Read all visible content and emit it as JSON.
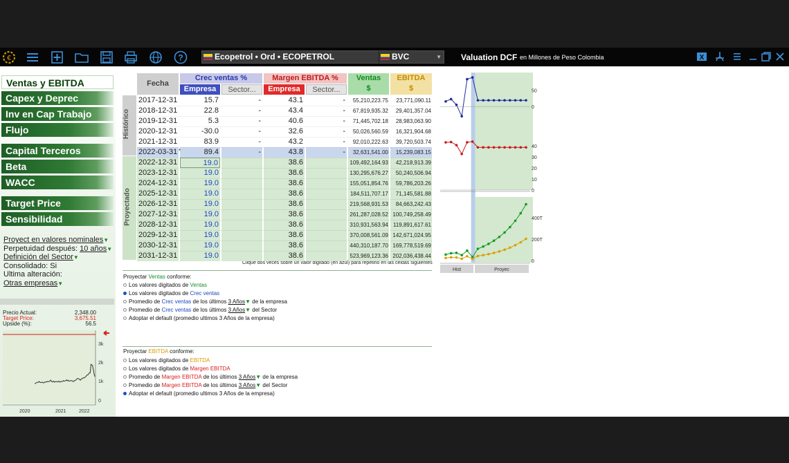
{
  "toolbar": {
    "company_combo": "Ecopetrol • Ord • ECOPETROL",
    "exchange_combo": "BVC",
    "title": "Valuation DCF",
    "subtitle": "en Millones de Peso Colombia",
    "icons": [
      "logo-icon",
      "menu-icon",
      "add-icon",
      "folder-icon",
      "save-icon",
      "print-icon",
      "globe-icon",
      "help-icon"
    ],
    "right_icons": [
      "excel-icon",
      "pdf-icon",
      "list-icon",
      "minimize-icon",
      "restore-icon",
      "close-icon"
    ]
  },
  "sidebar": {
    "nav": [
      "Ventas y EBITDA",
      "Capex y Deprec",
      "Inv en Cap Trabajo",
      "Flujo",
      "Capital Terceros",
      "Beta",
      "WACC",
      "Target Price",
      "Sensibilidad"
    ],
    "settings": {
      "proyect": "Proyect en valores nominales",
      "perpetuidad_label": "Perpetuidad después:",
      "perpetuidad_value": "10 años",
      "definicion": "Definición del Sector",
      "consolidado": "Consolidado: Si",
      "ultima": "Ultima alteración:",
      "otras": "Otras empresas"
    },
    "price": {
      "actual_label": "Precio Actual:",
      "actual_value": "2,348.00",
      "target_label": "Target Price:",
      "target_value": "3,675.51",
      "upside_label": "Upside (%):",
      "upside_value": "56.5"
    },
    "mini_chart": {
      "yticks": [
        "3k",
        "2k",
        "1k",
        "0"
      ],
      "xticks": [
        "2020",
        "2021",
        "2022"
      ]
    }
  },
  "table": {
    "headers": {
      "fecha": "Fecha",
      "crec": "Crec ventas %",
      "margen": "Margen EBITDA %",
      "ventas": "Ventas",
      "ventas_unit": "$",
      "ebitda": "EBITDA",
      "ebitda_unit": "$",
      "empresa": "Empresa",
      "sector": "Sector..."
    },
    "sections": {
      "historico": "Histórico",
      "proyectado": "Proyectado"
    },
    "rows": [
      {
        "fecha": "2017-12-31",
        "crec": "15.7",
        "crec_s": "-",
        "margen": "43.1",
        "margen_s": "-",
        "ventas": "55,210,223.75",
        "ebitda": "23,771,090.11",
        "type": "hist"
      },
      {
        "fecha": "2018-12-31",
        "crec": "22.8",
        "crec_s": "-",
        "margen": "43.4",
        "margen_s": "-",
        "ventas": "67,819,935.32",
        "ebitda": "29,401,357.04",
        "type": "hist"
      },
      {
        "fecha": "2019-12-31",
        "crec": "5.3",
        "crec_s": "-",
        "margen": "40.6",
        "margen_s": "-",
        "ventas": "71,445,702.18",
        "ebitda": "28,983,063.90",
        "type": "hist"
      },
      {
        "fecha": "2020-12-31",
        "crec": "-30.0",
        "crec_s": "-",
        "margen": "32.6",
        "margen_s": "-",
        "ventas": "50,026,560.59",
        "ebitda": "16,321,904.68",
        "type": "hist"
      },
      {
        "fecha": "2021-12-31",
        "crec": "83.9",
        "crec_s": "-",
        "margen": "43.2",
        "margen_s": "-",
        "ventas": "92,010,222.63",
        "ebitda": "39,720,503.74",
        "type": "hist"
      },
      {
        "fecha": "2022-03-31",
        "crec": "89.4",
        "crec_s": "-",
        "margen": "43.8",
        "margen_s": "-",
        "ventas": "32,631,541.00",
        "ebitda": "15,239,083.15",
        "type": "sel"
      },
      {
        "fecha": "2022-12-31",
        "crec": "19.0",
        "crec_s": "",
        "margen": "38.6",
        "margen_s": "",
        "ventas": "109,492,164.93",
        "ebitda": "42,218,913.39",
        "type": "proj"
      },
      {
        "fecha": "2023-12-31",
        "crec": "19.0",
        "crec_s": "",
        "margen": "38.6",
        "margen_s": "",
        "ventas": "130,295,676.27",
        "ebitda": "50,240,506.94",
        "type": "proj"
      },
      {
        "fecha": "2024-12-31",
        "crec": "19.0",
        "crec_s": "",
        "margen": "38.6",
        "margen_s": "",
        "ventas": "155,051,854.76",
        "ebitda": "59,786,203.26",
        "type": "proj"
      },
      {
        "fecha": "2025-12-31",
        "crec": "19.0",
        "crec_s": "",
        "margen": "38.6",
        "margen_s": "",
        "ventas": "184,511,707.17",
        "ebitda": "71,145,581.88",
        "type": "proj"
      },
      {
        "fecha": "2026-12-31",
        "crec": "19.0",
        "crec_s": "",
        "margen": "38.6",
        "margen_s": "",
        "ventas": "219,568,931.53",
        "ebitda": "84,663,242.43",
        "type": "proj"
      },
      {
        "fecha": "2027-12-31",
        "crec": "19.0",
        "crec_s": "",
        "margen": "38.6",
        "margen_s": "",
        "ventas": "261,287,028.52",
        "ebitda": "100,749,258.49",
        "type": "proj"
      },
      {
        "fecha": "2028-12-31",
        "crec": "19.0",
        "crec_s": "",
        "margen": "38.6",
        "margen_s": "",
        "ventas": "310,931,563.94",
        "ebitda": "119,891,617.61",
        "type": "proj"
      },
      {
        "fecha": "2029-12-31",
        "crec": "19.0",
        "crec_s": "",
        "margen": "38.6",
        "margen_s": "",
        "ventas": "370,008,561.09",
        "ebitda": "142,671,024.95",
        "type": "proj"
      },
      {
        "fecha": "2030-12-31",
        "crec": "19.0",
        "crec_s": "",
        "margen": "38.6",
        "margen_s": "",
        "ventas": "440,310,187.70",
        "ebitda": "169,778,519.69",
        "type": "proj"
      },
      {
        "fecha": "2031-12-31",
        "crec": "19.0",
        "crec_s": "",
        "margen": "38.6",
        "margen_s": "",
        "ventas": "523,969,123.36",
        "ebitda": "202,036,438.44",
        "type": "proj"
      }
    ],
    "note": "Clique dos veces sobre un valor digitado (en azul) para repetirlo en las celdas siguientes"
  },
  "charts": {
    "crec_ticks": [
      "50",
      "0"
    ],
    "margen_ticks": [
      "40",
      "30",
      "20",
      "10",
      "0"
    ],
    "ventas_ticks": [
      "400T",
      "200T",
      "0"
    ],
    "footer_hist": "Hist",
    "footer_proyec": "Proyec",
    "series_crec": [
      15.7,
      22.8,
      5.3,
      -30.0,
      83.9,
      89.4,
      19,
      19,
      19,
      19,
      19,
      19,
      19,
      19,
      19,
      19
    ],
    "series_margen": [
      43.1,
      43.4,
      40.6,
      32.6,
      43.2,
      43.8,
      38.6,
      38.6,
      38.6,
      38.6,
      38.6,
      38.6,
      38.6,
      38.6,
      38.6,
      38.6
    ],
    "series_ventas": [
      55.2,
      67.8,
      71.4,
      50.0,
      92.0,
      32.6,
      109.5,
      130.3,
      155.1,
      184.5,
      219.6,
      261.3,
      310.9,
      370.0,
      440.3,
      524.0
    ],
    "series_ebitda": [
      23.8,
      29.4,
      29.0,
      16.3,
      39.7,
      15.2,
      42.2,
      50.2,
      59.8,
      71.1,
      84.7,
      100.7,
      119.9,
      142.7,
      169.8,
      202.0
    ],
    "colors": {
      "crec": "#1a2a9c",
      "margen": "#c81818",
      "ventas": "#129b1f",
      "ebitda": "#d9a100",
      "proj_bg": "#d3e8cf",
      "sel_band": "#b8cde8"
    }
  },
  "options_ventas": {
    "title_pre": "Proyectar ",
    "title_key": "Ventas",
    "title_post": " conforme:",
    "o1_pre": "Los valores digitados de ",
    "o1_key": "Ventas",
    "o2_pre": "Los valores digitados de ",
    "o2_key": "Crec ventas",
    "o3_pre": "Promedio de ",
    "o3_key": "Crec ventas",
    "o3_mid": " de los últimos ",
    "o3_link": "3 Años",
    "o3_post": " de la empresa",
    "o4_pre": "Promedio de ",
    "o4_key": "Crec ventas",
    "o4_mid": " de los últimos ",
    "o4_link": "3 Años",
    "o4_post": " del Sector",
    "o5": "Adoptar el default (promedio ultimos 3 Años de la empresa)"
  },
  "options_ebitda": {
    "title_pre": "Proyectar ",
    "title_key": "EBITDA",
    "title_post": " conforme:",
    "o1_pre": "Los valores digitados de ",
    "o1_key": "EBITDA",
    "o2_pre": "Los valores digitados de ",
    "o2_key": "Margen EBITDA",
    "o3_pre": "Promedio de ",
    "o3_key": "Margen EBITDA",
    "o3_mid": " de los últimos ",
    "o3_link": "3 Años",
    "o3_post": " de la empresa",
    "o4_pre": "Promedio de ",
    "o4_key": "Margen EBITDA",
    "o4_mid": " de los últimos ",
    "o4_link": "3 Años",
    "o4_post": " del Sector",
    "o5": "Adoptar el default (promedio ultimos 3 Años de la empresa)"
  }
}
